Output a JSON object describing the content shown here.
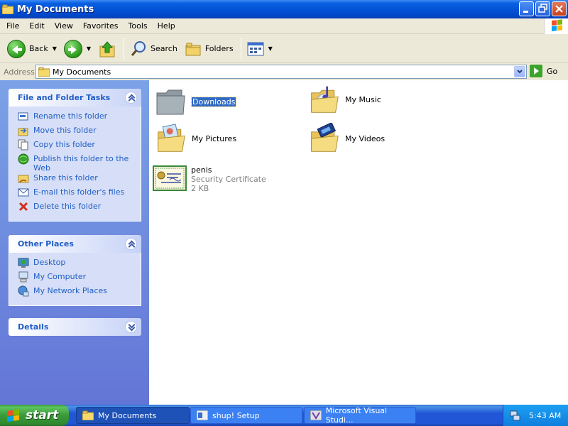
{
  "window": {
    "title": "My Documents"
  },
  "menu": [
    "File",
    "Edit",
    "View",
    "Favorites",
    "Tools",
    "Help"
  ],
  "toolbar": {
    "back": "Back",
    "search": "Search",
    "folders": "Folders"
  },
  "address": {
    "label": "Address",
    "value": "My Documents",
    "go": "Go"
  },
  "tasks_panel": {
    "title": "File and Folder Tasks",
    "items": [
      {
        "label": "Rename this folder",
        "icon": "rename-icon"
      },
      {
        "label": "Move this folder",
        "icon": "move-icon"
      },
      {
        "label": "Copy this folder",
        "icon": "copy-icon"
      },
      {
        "label": "Publish this folder to the Web",
        "icon": "publish-web-icon"
      },
      {
        "label": "Share this folder",
        "icon": "share-icon"
      },
      {
        "label": "E-mail this folder's files",
        "icon": "email-icon"
      },
      {
        "label": "Delete this folder",
        "icon": "delete-icon"
      }
    ]
  },
  "places_panel": {
    "title": "Other Places",
    "items": [
      {
        "label": "Desktop",
        "icon": "desktop-icon"
      },
      {
        "label": "My Computer",
        "icon": "computer-icon"
      },
      {
        "label": "My Network Places",
        "icon": "network-icon"
      }
    ]
  },
  "details_panel": {
    "title": "Details"
  },
  "files": [
    {
      "name": "Downloads",
      "type": "folder",
      "selected": true
    },
    {
      "name": "My Music",
      "type": "music-folder"
    },
    {
      "name": "My Pictures",
      "type": "pictures-folder"
    },
    {
      "name": "My Videos",
      "type": "videos-folder"
    },
    {
      "name": "penis",
      "type": "certificate",
      "kind": "Security Certificate",
      "size": "2 KB"
    }
  ],
  "taskbar": {
    "start": "start",
    "tasks": [
      "My Documents",
      "shup! Setup",
      "Microsoft Visual Studi..."
    ],
    "clock": "5:43 AM"
  }
}
